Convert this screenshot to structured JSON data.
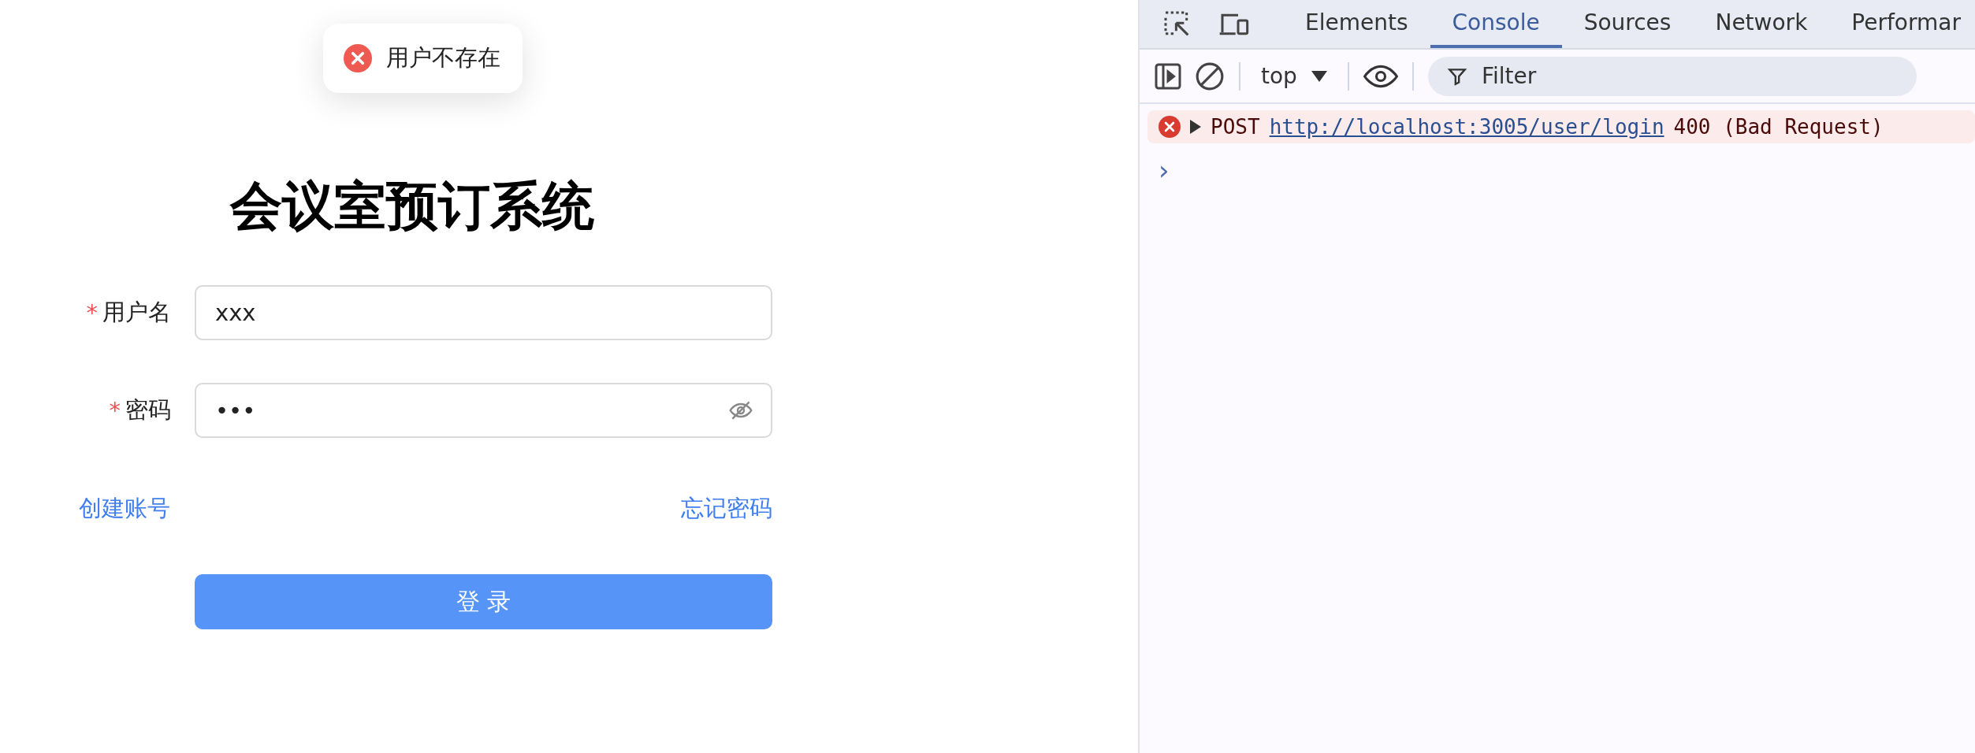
{
  "toast": {
    "kind": "error",
    "message": "用户不存在"
  },
  "login": {
    "title": "会议室预订系统",
    "fields": [
      {
        "kind": "text",
        "label": "用户名",
        "required_mark": "*",
        "value": "xxx"
      },
      {
        "kind": "password",
        "label": "密码",
        "required_mark": "*",
        "value": "•••"
      }
    ],
    "links": [
      "创建账号",
      "忘记密码"
    ],
    "submit": "登 录"
  },
  "devtools": {
    "tabs": [
      {
        "label": "Elements",
        "selected": false
      },
      {
        "label": "Console",
        "selected": true
      },
      {
        "label": "Sources",
        "selected": false
      },
      {
        "label": "Network",
        "selected": false
      },
      {
        "label": "Performar",
        "selected": false
      }
    ],
    "context": "top",
    "filter": {
      "placeholder": "Filter"
    },
    "messages": [
      {
        "kind": "error",
        "method": "POST",
        "url": "http://localhost:3005/user/login",
        "status": "400 (Bad Request)"
      }
    ],
    "prompt": "›"
  }
}
